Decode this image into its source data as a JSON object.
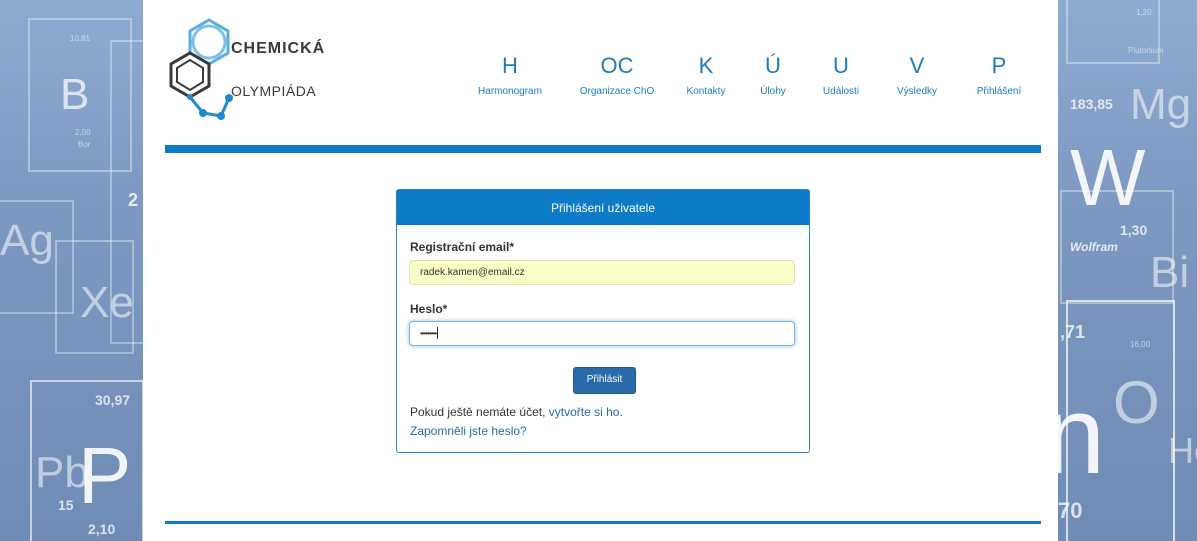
{
  "brand": {
    "line1": "CHEMICKÁ",
    "line2": "OLYMPIÁDA"
  },
  "nav": [
    {
      "letter": "H",
      "label": "Harmonogram"
    },
    {
      "letter": "OC",
      "label": "Organizace ChO"
    },
    {
      "letter": "K",
      "label": "Kontakty"
    },
    {
      "letter": "Ú",
      "label": "Úlohy"
    },
    {
      "letter": "U",
      "label": "Události"
    },
    {
      "letter": "V",
      "label": "Výsledky"
    },
    {
      "letter": "P",
      "label": "Přihlášení"
    }
  ],
  "login": {
    "title": "Přihlášení uživatele",
    "email_label": "Registrační email*",
    "email_value": "radek.kamen@email.cz",
    "password_label": "Heslo*",
    "password_value": "•••••••••",
    "submit_label": "Přihlásit",
    "no_account_text": "Pokud ještě nemáte účet,",
    "create_link": "vytvořte si ho.",
    "forgot_link": "Zapomněli jste heslo?"
  },
  "background": {
    "left": {
      "b": "B",
      "b_mass": "10,81",
      "b_en": "2,00",
      "b_name": "Bor",
      "ag": "Ag",
      "xe": "Xe",
      "two": "2",
      "p_mass": "30,97",
      "pb": "Pb",
      "p": "P",
      "fifteen": "15",
      "p_en": "2,10"
    },
    "right": {
      "top_mass": "1,20",
      "top_name": "Plutonium",
      "mg_mass": "183,85",
      "mg": "Mg",
      "w": "W",
      "w_en": "1,30",
      "w_name": "Wolfram",
      "bi": "Bi",
      "num71": ",71",
      "sixteen": "16,00",
      "o": "O",
      "n": "n",
      "he": "He",
      "seventy": "70"
    }
  },
  "colors": {
    "accent": "#0e7bc8",
    "button": "#2a6aa8",
    "autofill": "#fafdc5"
  }
}
